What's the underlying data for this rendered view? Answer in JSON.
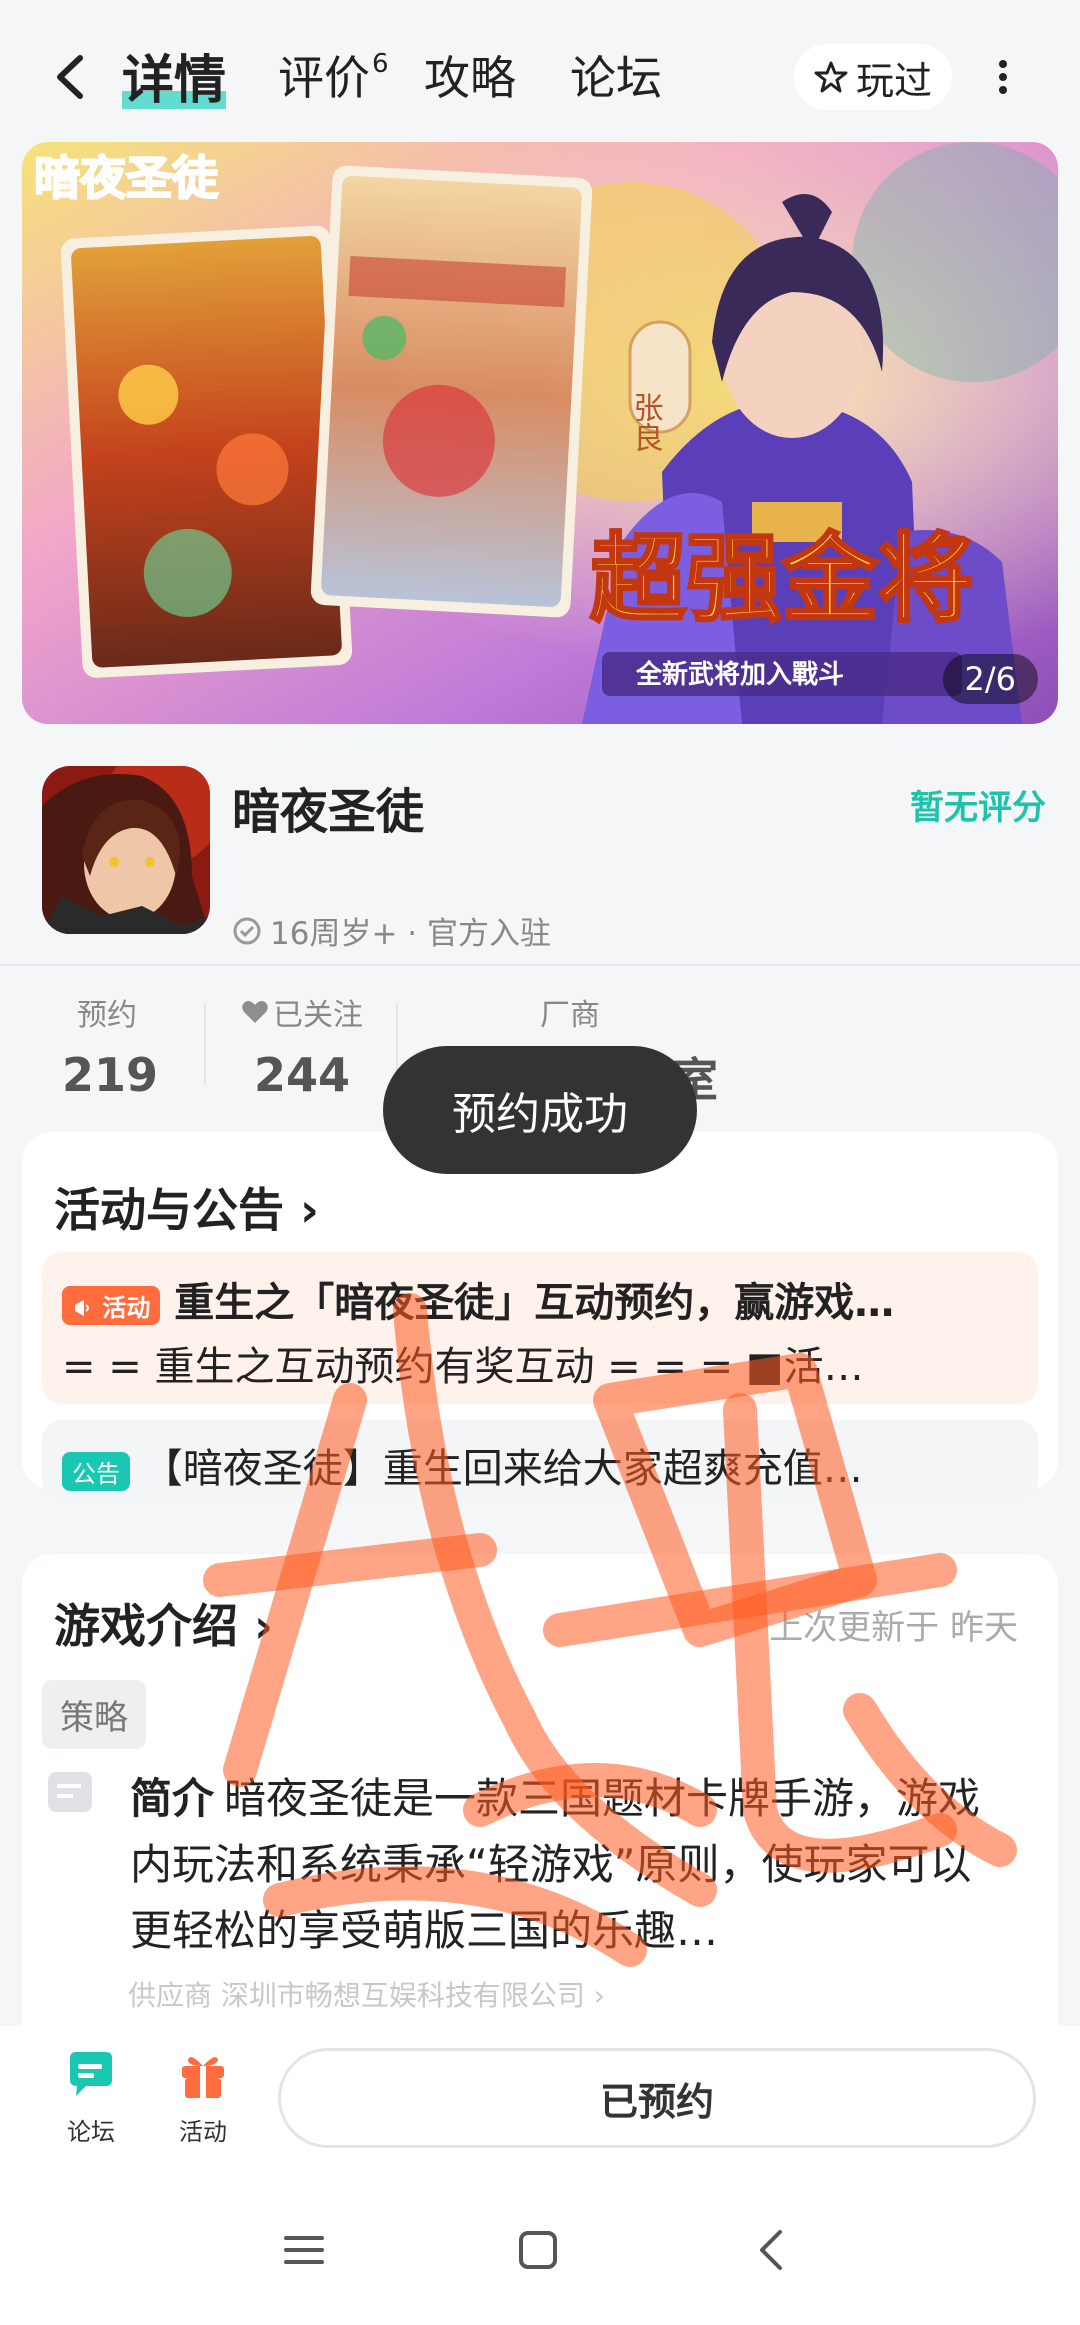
{
  "header": {
    "tabs": [
      {
        "label": "详情"
      },
      {
        "label": "评价",
        "badge": "6"
      },
      {
        "label": "攻略"
      },
      {
        "label": "论坛"
      }
    ],
    "played_label": "玩过"
  },
  "banner": {
    "counter": "2/6",
    "art_text": {
      "logo": "暗夜圣徒",
      "headline": "超强金将",
      "subline": "全新武将加入戰斗",
      "hero_name": "张良"
    }
  },
  "game": {
    "name": "暗夜圣徒",
    "rating_text": "暂无评分",
    "age_official": "16周岁+ · 官方入驻"
  },
  "stats": {
    "reserve_label": "预约",
    "reserve_value": "219",
    "follow_label": "已关注",
    "follow_value": "244",
    "vendor_label": "厂商",
    "vendor_value_partial": "室"
  },
  "toast": "预约成功",
  "activities": {
    "title": "活动与公告 ›",
    "activity_tag": "活动",
    "activity_line1": "重生之「暗夜圣徒」互动预约，赢游戏…",
    "activity_line2": "= = 重生之互动预约有奖互动 = = =  ■活…",
    "notice_tag": "公告",
    "notice_line": "【暗夜圣徒】重生回来给大家超爽充值…"
  },
  "intro": {
    "title": "游戏介绍 ›",
    "updated": "上次更新于 昨天",
    "category": "策略",
    "summary_label": "简介",
    "summary_text": "暗夜圣徒是一款三国题材卡牌手游，游戏内玩法和系统秉承“轻游戏”原则，使玩家可以更轻松的享受萌版三国的乐趣…",
    "supplier": "供应商  深圳市畅想互娱科技有限公司 ›"
  },
  "bottom": {
    "forum_label": "论坛",
    "activity_label": "活动",
    "reserved_label": "已预约"
  },
  "colors": {
    "accent": "#1cc3ad",
    "activity_tag": "#ff6d3f",
    "notice_tag": "#19c7b3",
    "activity_bg": "#fff1ec",
    "notice_bg": "#f4f5f7"
  }
}
